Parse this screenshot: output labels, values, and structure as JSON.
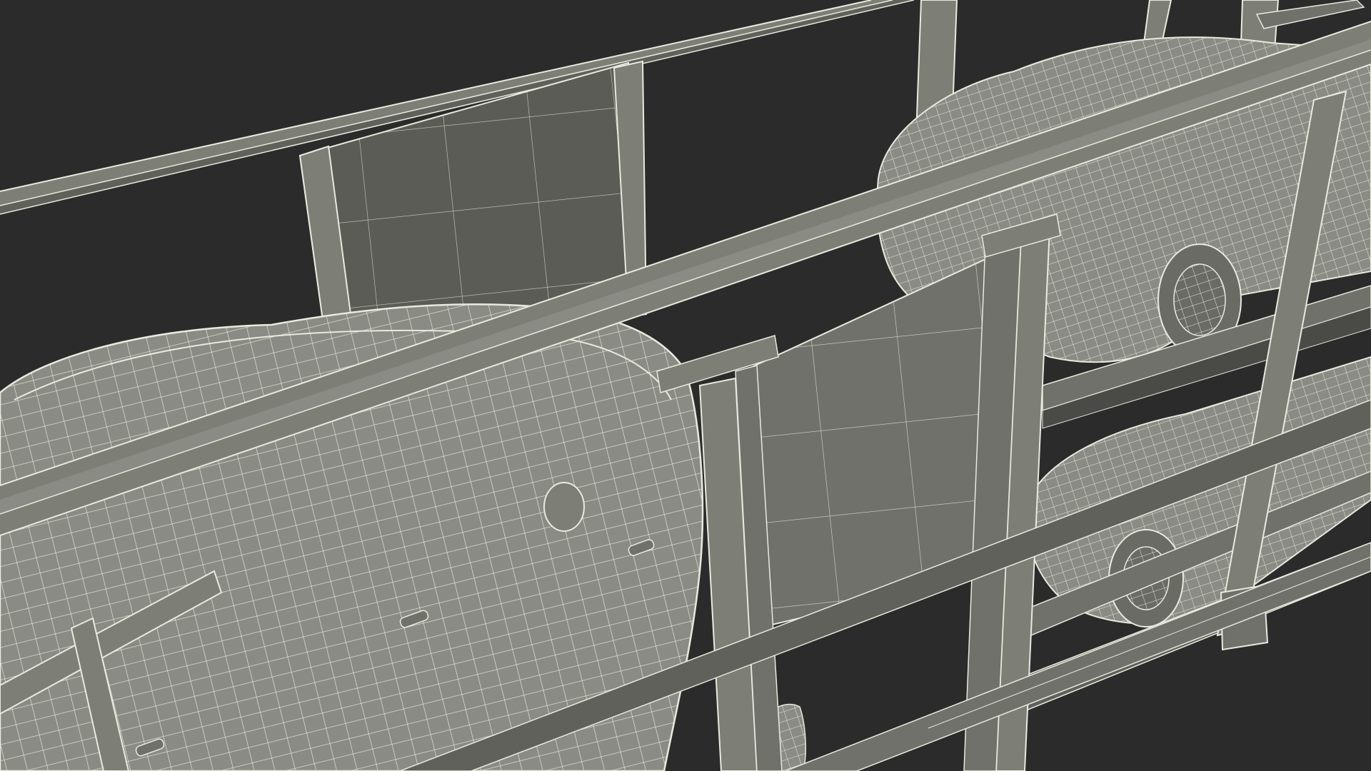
{
  "scene": {
    "subject": "wireframe-car-carrier-trailer",
    "render_mode": "wireframe-over-shaded",
    "colors": {
      "background": "#2b2b2b",
      "metal": "#7d7f76",
      "metal_dark": "#5f615a",
      "panel": "#6f716a",
      "car_body": "#8a8b84",
      "car_dark": "#4a4b47",
      "wire": "#e9e9df",
      "shadow": "#1f1f1d"
    }
  }
}
